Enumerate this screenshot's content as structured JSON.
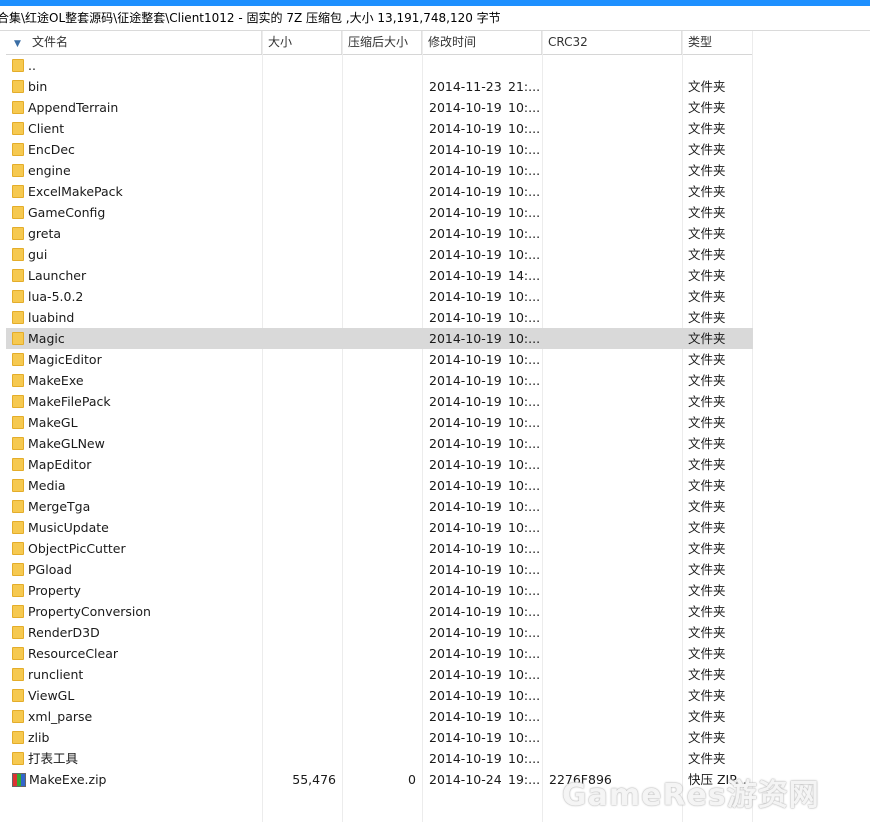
{
  "pathbar": {
    "text": "合集\\红途OL整套源码\\征途整套\\Client1012 - 固实的 7Z 压缩包 ,大小 13,191,748,120 字节"
  },
  "columns": {
    "name": "文件名",
    "size": "大小",
    "packed": "压缩后大小",
    "modified": "修改时间",
    "crc": "CRC32",
    "type": "类型"
  },
  "rows": [
    {
      "name": "..",
      "size": "",
      "packed": "",
      "date": "",
      "time": "",
      "crc": "",
      "type": "",
      "icon": "folder"
    },
    {
      "name": "bin",
      "size": "",
      "packed": "",
      "date": "2014-11-23",
      "time": "21:...",
      "crc": "",
      "type": "文件夹",
      "icon": "folder"
    },
    {
      "name": "AppendTerrain",
      "size": "",
      "packed": "",
      "date": "2014-10-19",
      "time": "10:...",
      "crc": "",
      "type": "文件夹",
      "icon": "folder"
    },
    {
      "name": "Client",
      "size": "",
      "packed": "",
      "date": "2014-10-19",
      "time": "10:...",
      "crc": "",
      "type": "文件夹",
      "icon": "folder"
    },
    {
      "name": "EncDec",
      "size": "",
      "packed": "",
      "date": "2014-10-19",
      "time": "10:...",
      "crc": "",
      "type": "文件夹",
      "icon": "folder"
    },
    {
      "name": "engine",
      "size": "",
      "packed": "",
      "date": "2014-10-19",
      "time": "10:...",
      "crc": "",
      "type": "文件夹",
      "icon": "folder"
    },
    {
      "name": "ExcelMakePack",
      "size": "",
      "packed": "",
      "date": "2014-10-19",
      "time": "10:...",
      "crc": "",
      "type": "文件夹",
      "icon": "folder"
    },
    {
      "name": "GameConfig",
      "size": "",
      "packed": "",
      "date": "2014-10-19",
      "time": "10:...",
      "crc": "",
      "type": "文件夹",
      "icon": "folder"
    },
    {
      "name": "greta",
      "size": "",
      "packed": "",
      "date": "2014-10-19",
      "time": "10:...",
      "crc": "",
      "type": "文件夹",
      "icon": "folder"
    },
    {
      "name": "gui",
      "size": "",
      "packed": "",
      "date": "2014-10-19",
      "time": "10:...",
      "crc": "",
      "type": "文件夹",
      "icon": "folder"
    },
    {
      "name": "Launcher",
      "size": "",
      "packed": "",
      "date": "2014-10-19",
      "time": "14:...",
      "crc": "",
      "type": "文件夹",
      "icon": "folder"
    },
    {
      "name": "lua-5.0.2",
      "size": "",
      "packed": "",
      "date": "2014-10-19",
      "time": "10:...",
      "crc": "",
      "type": "文件夹",
      "icon": "folder"
    },
    {
      "name": "luabind",
      "size": "",
      "packed": "",
      "date": "2014-10-19",
      "time": "10:...",
      "crc": "",
      "type": "文件夹",
      "icon": "folder"
    },
    {
      "name": "Magic",
      "size": "",
      "packed": "",
      "date": "2014-10-19",
      "time": "10:...",
      "crc": "",
      "type": "文件夹",
      "icon": "folder",
      "selected": true
    },
    {
      "name": "MagicEditor",
      "size": "",
      "packed": "",
      "date": "2014-10-19",
      "time": "10:...",
      "crc": "",
      "type": "文件夹",
      "icon": "folder"
    },
    {
      "name": "MakeExe",
      "size": "",
      "packed": "",
      "date": "2014-10-19",
      "time": "10:...",
      "crc": "",
      "type": "文件夹",
      "icon": "folder"
    },
    {
      "name": "MakeFilePack",
      "size": "",
      "packed": "",
      "date": "2014-10-19",
      "time": "10:...",
      "crc": "",
      "type": "文件夹",
      "icon": "folder"
    },
    {
      "name": "MakeGL",
      "size": "",
      "packed": "",
      "date": "2014-10-19",
      "time": "10:...",
      "crc": "",
      "type": "文件夹",
      "icon": "folder"
    },
    {
      "name": "MakeGLNew",
      "size": "",
      "packed": "",
      "date": "2014-10-19",
      "time": "10:...",
      "crc": "",
      "type": "文件夹",
      "icon": "folder"
    },
    {
      "name": "MapEditor",
      "size": "",
      "packed": "",
      "date": "2014-10-19",
      "time": "10:...",
      "crc": "",
      "type": "文件夹",
      "icon": "folder"
    },
    {
      "name": "Media",
      "size": "",
      "packed": "",
      "date": "2014-10-19",
      "time": "10:...",
      "crc": "",
      "type": "文件夹",
      "icon": "folder"
    },
    {
      "name": "MergeTga",
      "size": "",
      "packed": "",
      "date": "2014-10-19",
      "time": "10:...",
      "crc": "",
      "type": "文件夹",
      "icon": "folder"
    },
    {
      "name": "MusicUpdate",
      "size": "",
      "packed": "",
      "date": "2014-10-19",
      "time": "10:...",
      "crc": "",
      "type": "文件夹",
      "icon": "folder"
    },
    {
      "name": "ObjectPicCutter",
      "size": "",
      "packed": "",
      "date": "2014-10-19",
      "time": "10:...",
      "crc": "",
      "type": "文件夹",
      "icon": "folder"
    },
    {
      "name": "PGload",
      "size": "",
      "packed": "",
      "date": "2014-10-19",
      "time": "10:...",
      "crc": "",
      "type": "文件夹",
      "icon": "folder"
    },
    {
      "name": "Property",
      "size": "",
      "packed": "",
      "date": "2014-10-19",
      "time": "10:...",
      "crc": "",
      "type": "文件夹",
      "icon": "folder"
    },
    {
      "name": "PropertyConversion",
      "size": "",
      "packed": "",
      "date": "2014-10-19",
      "time": "10:...",
      "crc": "",
      "type": "文件夹",
      "icon": "folder"
    },
    {
      "name": "RenderD3D",
      "size": "",
      "packed": "",
      "date": "2014-10-19",
      "time": "10:...",
      "crc": "",
      "type": "文件夹",
      "icon": "folder"
    },
    {
      "name": "ResourceClear",
      "size": "",
      "packed": "",
      "date": "2014-10-19",
      "time": "10:...",
      "crc": "",
      "type": "文件夹",
      "icon": "folder"
    },
    {
      "name": "runclient",
      "size": "",
      "packed": "",
      "date": "2014-10-19",
      "time": "10:...",
      "crc": "",
      "type": "文件夹",
      "icon": "folder"
    },
    {
      "name": "ViewGL",
      "size": "",
      "packed": "",
      "date": "2014-10-19",
      "time": "10:...",
      "crc": "",
      "type": "文件夹",
      "icon": "folder"
    },
    {
      "name": "xml_parse",
      "size": "",
      "packed": "",
      "date": "2014-10-19",
      "time": "10:...",
      "crc": "",
      "type": "文件夹",
      "icon": "folder"
    },
    {
      "name": "zlib",
      "size": "",
      "packed": "",
      "date": "2014-10-19",
      "time": "10:...",
      "crc": "",
      "type": "文件夹",
      "icon": "folder"
    },
    {
      "name": "打表工具",
      "size": "",
      "packed": "",
      "date": "2014-10-19",
      "time": "10:...",
      "crc": "",
      "type": "文件夹",
      "icon": "folder"
    },
    {
      "name": "MakeExe.zip",
      "size": "55,476",
      "packed": "0",
      "date": "2014-10-24",
      "time": "19:...",
      "crc": "2276F896",
      "type": "快压 ZIP...",
      "icon": "zip"
    }
  ],
  "watermark": "GameRes游资网",
  "colors": {
    "accent": "#1e90ff",
    "selection": "#d9d9d9",
    "folder": "#f6c950"
  }
}
